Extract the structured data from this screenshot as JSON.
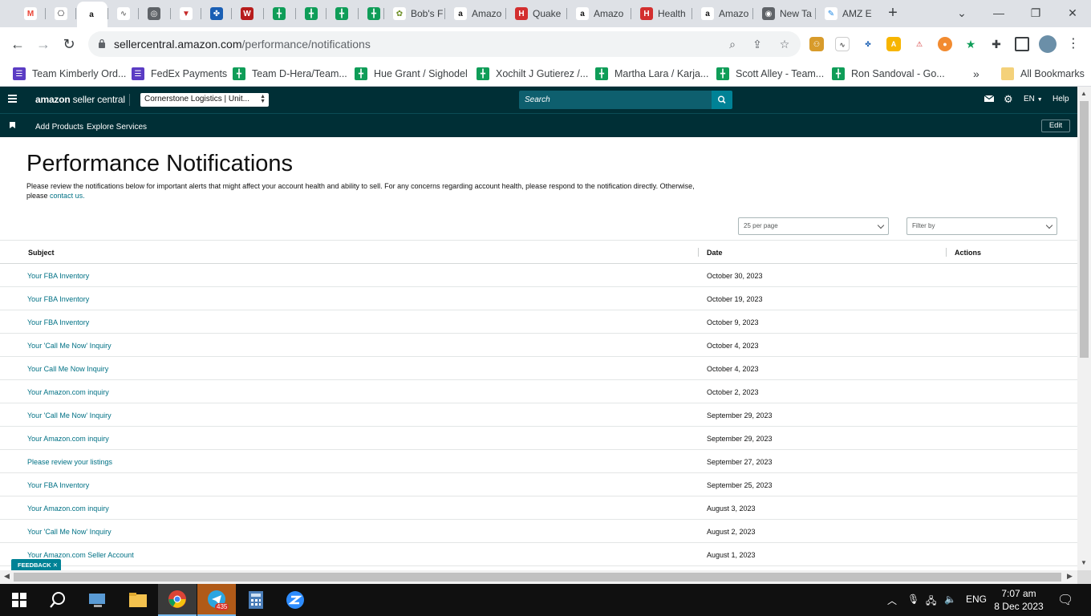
{
  "browser": {
    "tabs": [
      {
        "title": "",
        "icon": "gmail-icon"
      },
      {
        "title": "",
        "icon": "chatgpt-icon"
      },
      {
        "title": "",
        "icon": "amazon-icon",
        "active": true
      },
      {
        "title": "",
        "icon": "web-icon"
      },
      {
        "title": "",
        "icon": "globe-icon"
      },
      {
        "title": "",
        "icon": "redflag-icon"
      },
      {
        "title": "",
        "icon": "diamond-icon"
      },
      {
        "title": "",
        "icon": "wolters-icon"
      },
      {
        "title": "",
        "icon": "sheets-icon"
      },
      {
        "title": "",
        "icon": "sheets-icon"
      },
      {
        "title": "",
        "icon": "sheets-icon"
      },
      {
        "title": "",
        "icon": "sheets-icon"
      },
      {
        "title": "Bob's F",
        "icon": "plant-icon"
      },
      {
        "title": "Amazo",
        "icon": "amazon-icon"
      },
      {
        "title": "Quake",
        "icon": "helium-icon"
      },
      {
        "title": "Amazo",
        "icon": "amazon-icon"
      },
      {
        "title": "Health",
        "icon": "helium-icon"
      },
      {
        "title": "Amazo",
        "icon": "amazon-icon"
      },
      {
        "title": "New Ta",
        "icon": "chrome-icon"
      },
      {
        "title": "AMZ E",
        "icon": "pen-icon"
      }
    ],
    "url_host": "sellercentral.amazon.com",
    "url_path": "/performance/notifications",
    "bookmarks": [
      {
        "label": "Team Kimberly Ord...",
        "icon": "purple"
      },
      {
        "label": "FedEx Payments",
        "icon": "purple"
      },
      {
        "label": "Team D-Hera/Team...",
        "icon": "green"
      },
      {
        "label": "Hue Grant / Sighodel",
        "icon": "green"
      },
      {
        "label": "Xochilt J Gutierez /...",
        "icon": "green"
      },
      {
        "label": "Martha Lara / Karja...",
        "icon": "green"
      },
      {
        "label": "Scott Alley - Team...",
        "icon": "green"
      },
      {
        "label": "Ron Sandoval - Go...",
        "icon": "green"
      }
    ],
    "all_bookmarks": "All Bookmarks"
  },
  "seller_central": {
    "logo_brand": "amazon",
    "logo_text": "seller central",
    "marketplace": "Cornerstone Logistics | Unit...",
    "search_placeholder": "Search",
    "language": "EN",
    "help": "Help",
    "subnav": [
      "Add Products",
      "Explore Services"
    ],
    "edit": "Edit"
  },
  "page": {
    "title": "Performance Notifications",
    "description": "Please review the notifications below for important alerts that might affect your account health and ability to sell. For any concerns regarding account health, please respond to the notification directly. Otherwise, please",
    "contact_link": "contact us.",
    "per_page": "25 per page",
    "filter_placeholder": "Filter by",
    "columns": {
      "subject": "Subject",
      "date": "Date",
      "actions": "Actions"
    },
    "rows": [
      {
        "subject": "Your FBA Inventory",
        "date": "October 30, 2023"
      },
      {
        "subject": "Your FBA Inventory",
        "date": "October 19, 2023"
      },
      {
        "subject": "Your FBA Inventory",
        "date": "October 9, 2023"
      },
      {
        "subject": "Your 'Call Me Now' Inquiry",
        "date": "October 4, 2023"
      },
      {
        "subject": "Your Call Me Now Inquiry",
        "date": "October 4, 2023"
      },
      {
        "subject": "Your Amazon.com inquiry",
        "date": "October 2, 2023"
      },
      {
        "subject": "Your 'Call Me Now' Inquiry",
        "date": "September 29, 2023"
      },
      {
        "subject": "Your Amazon.com inquiry",
        "date": "September 29, 2023"
      },
      {
        "subject": "Please review your listings",
        "date": "September 27, 2023"
      },
      {
        "subject": "Your FBA Inventory",
        "date": "September 25, 2023"
      },
      {
        "subject": "Your Amazon.com inquiry",
        "date": "August 3, 2023"
      },
      {
        "subject": "Your 'Call Me Now' Inquiry",
        "date": "August 2, 2023"
      },
      {
        "subject": "Your Amazon.com Seller Account",
        "date": "August 1, 2023"
      }
    ],
    "feedback": "FEEDBACK"
  },
  "taskbar": {
    "telegram_badge": "435",
    "language": "ENG",
    "time": "7:07 am",
    "date": "8 Dec 2023"
  },
  "colors": {
    "header_bg": "#002f36",
    "link": "#007185",
    "accent": "#008296"
  }
}
